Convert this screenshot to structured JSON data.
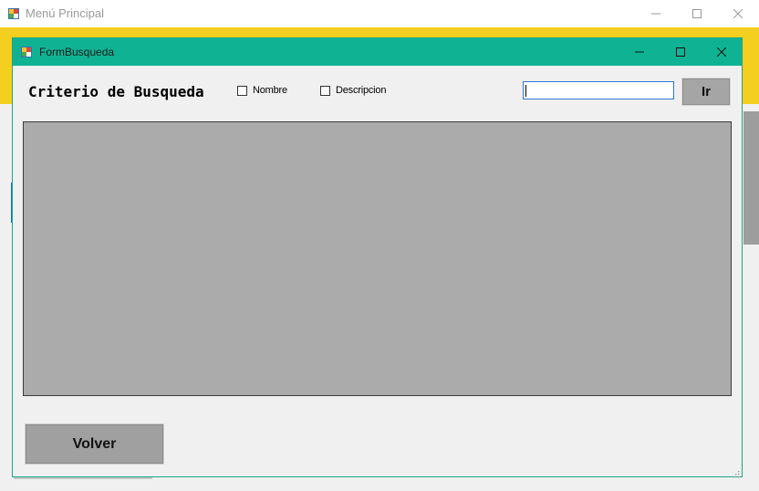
{
  "parent_window": {
    "title": "Menú Principal",
    "controls": {
      "minimize": "—",
      "maximize": "☐",
      "close": "✕"
    },
    "accent_color": "#f5cf1f"
  },
  "form": {
    "title": "FormBusqueda",
    "titlebar_color": "#0fb394",
    "controls": {
      "minimize": "—",
      "maximize": "☐",
      "close": "✕"
    },
    "criteria_label": "Criterio de Busqueda",
    "checkboxes": [
      {
        "label": "Nombre",
        "checked": false
      },
      {
        "label": "Descripcion",
        "checked": false
      }
    ],
    "search": {
      "value": "",
      "placeholder": ""
    },
    "go_button": "Ir",
    "back_button": "Volver"
  }
}
